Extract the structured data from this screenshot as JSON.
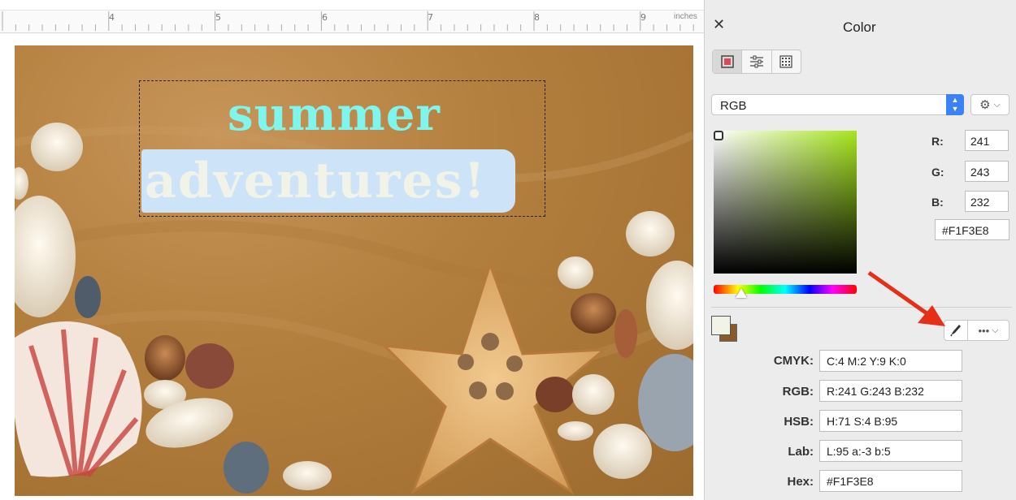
{
  "ruler": {
    "numbers": [
      "4",
      "5",
      "6",
      "7",
      "8",
      "9"
    ],
    "units": "inches"
  },
  "canvas": {
    "text_line1": "summer",
    "text_line2": "adventures!"
  },
  "panel": {
    "title": "Color",
    "close_symbol": "✕",
    "mode_buttons": [
      "color-viewers-icon",
      "color-sliders-icon",
      "color-palettes-icon"
    ],
    "model_select": "RGB",
    "rgb": {
      "r_label": "R:",
      "r_value": "241",
      "g_label": "G:",
      "g_value": "243",
      "b_label": "B:",
      "b_value": "232",
      "hex": "#F1F3E8"
    },
    "values": [
      {
        "label": "CMYK:",
        "value": "C:4 M:2 Y:9 K:0"
      },
      {
        "label": "RGB:",
        "value": "R:241 G:243 B:232"
      },
      {
        "label": "HSB:",
        "value": "H:71 S:4 B:95"
      },
      {
        "label": "Lab:",
        "value": "L:95 a:-3 b:5"
      },
      {
        "label": "Hex:",
        "value": "#F1F3E8"
      }
    ],
    "more_symbol": "•••",
    "colors": {
      "current_fill": "#F1F3E8",
      "hue_color": "#A6E51E",
      "accent": "#3B82F6",
      "arrow": "#E53017"
    }
  }
}
